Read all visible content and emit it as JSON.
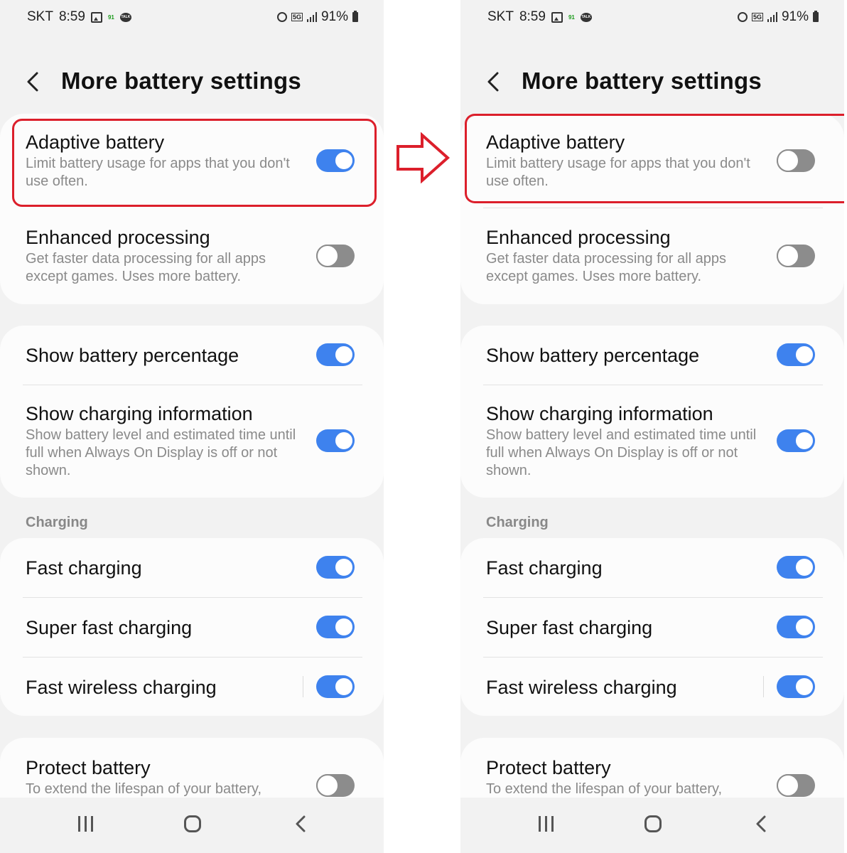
{
  "status_bar": {
    "carrier": "SKT",
    "time": "8:59",
    "notif_badge": "91",
    "talk_icon_text": "TALK",
    "network": "5G",
    "battery_percent": "91%"
  },
  "header": {
    "title": "More battery settings"
  },
  "settings": {
    "adaptive_battery": {
      "title": "Adaptive battery",
      "desc": "Limit battery usage for apps that you don't use often."
    },
    "enhanced_processing": {
      "title": "Enhanced processing",
      "desc": "Get faster data processing for all apps except games. Uses more battery.",
      "enabled": false
    },
    "show_battery_percentage": {
      "title": "Show battery percentage",
      "enabled": true
    },
    "show_charging_information": {
      "title": "Show charging information",
      "desc": "Show battery level and estimated time until full when Always On Display is off or not shown.",
      "enabled": true
    },
    "charging_section_label": "Charging",
    "fast_charging": {
      "title": "Fast charging",
      "enabled": true
    },
    "super_fast_charging": {
      "title": "Super fast charging",
      "enabled": true
    },
    "fast_wireless_charging": {
      "title": "Fast wireless charging",
      "enabled": true
    },
    "protect_battery": {
      "title": "Protect battery",
      "desc": "To extend the lifespan of your battery,",
      "enabled": false
    }
  },
  "comparison": {
    "before": {
      "adaptive_battery_enabled": true
    },
    "after": {
      "adaptive_battery_enabled": false
    }
  },
  "colors": {
    "toggle_on": "#3e82ee",
    "toggle_off": "#8c8c8c",
    "highlight": "#dc1f2b",
    "background": "#f2f2f2",
    "card": "#fcfcfc"
  },
  "icons": {
    "back": "chevron-left-icon",
    "arrow": "right-arrow-icon",
    "nav_recents": "recents-icon",
    "nav_home": "home-icon",
    "nav_back": "back-icon"
  }
}
